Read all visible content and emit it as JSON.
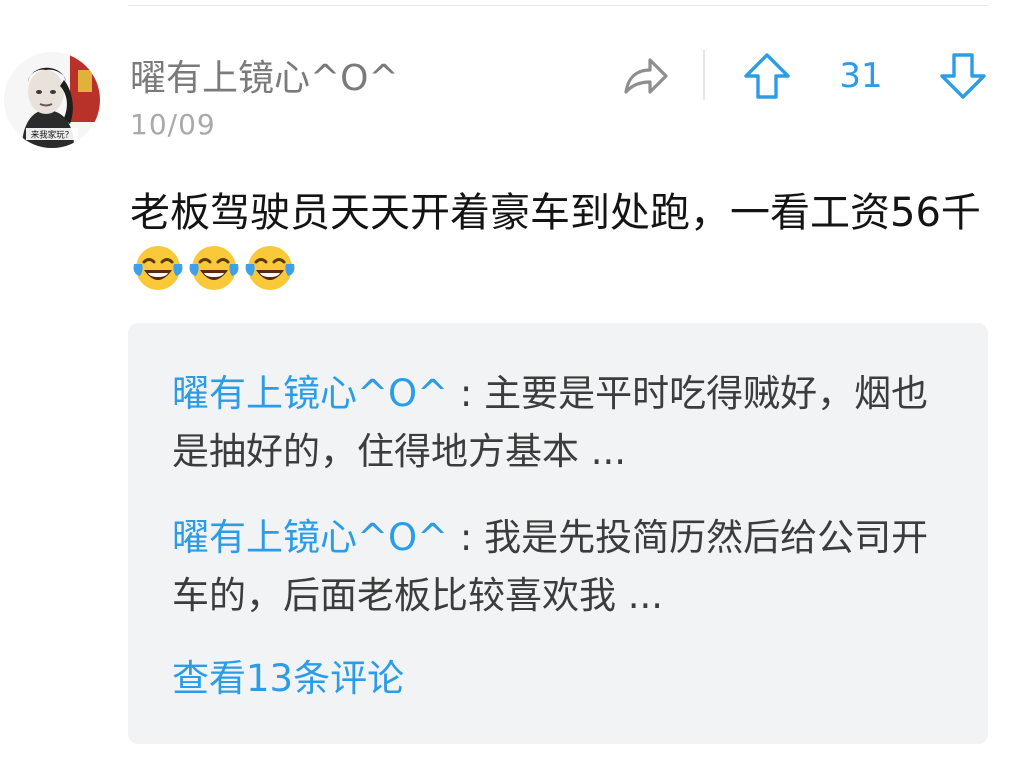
{
  "comment": {
    "username": "曜有上镜心^O^",
    "date": "10/09",
    "text": "老板驾驶员天天开着豪车到处跑，一看工资56千",
    "emojis": [
      "face-with-tears-of-joy-icon",
      "face-with-tears-of-joy-icon",
      "face-with-tears-of-joy-icon"
    ],
    "actions": {
      "share_icon": "share-arrow-icon",
      "upvote_icon": "arrow-up-icon",
      "vote_count": "31",
      "downvote_icon": "arrow-down-icon"
    },
    "avatar_caption": "来我家玩？"
  },
  "replies": [
    {
      "user": "曜有上镜心^O^",
      "separator": " : ",
      "text": "主要是平时吃得贼好，烟也是抽好的，住得地方基本 ..."
    },
    {
      "user": "曜有上镜心^O^",
      "separator": " : ",
      "text": "我是先投简历然后给公司开车的，后面老板比较喜欢我 ..."
    }
  ],
  "see_more": "查看13条评论",
  "colors": {
    "accent": "#2a9de6",
    "username": "#7a7a7a",
    "date": "#a9a9a9",
    "text": "#141414",
    "reply_bg": "#f2f3f5"
  }
}
